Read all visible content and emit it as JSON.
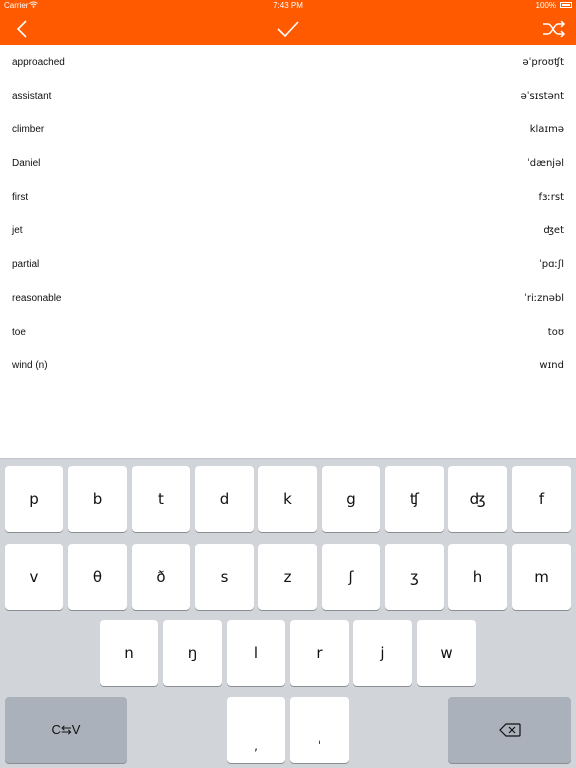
{
  "status_bar": {
    "carrier": "Carrier",
    "time": "7:43 PM",
    "battery": "100%"
  },
  "nav": {
    "accent_color": "#ff5a00",
    "back_icon": "chevron-left-icon",
    "confirm_icon": "checkmark-icon",
    "shuffle_icon": "shuffle-icon"
  },
  "words": [
    {
      "word": "approached",
      "ipa": "əˈproʊʧt"
    },
    {
      "word": "assistant",
      "ipa": "əˈsɪstənt"
    },
    {
      "word": "climber",
      "ipa": "klaɪmə"
    },
    {
      "word": "Daniel",
      "ipa": "ˈdænjəl"
    },
    {
      "word": "first",
      "ipa": "fɜːrst"
    },
    {
      "word": "jet",
      "ipa": "ʤet"
    },
    {
      "word": "partial",
      "ipa": "ˈpɑːʃl"
    },
    {
      "word": "reasonable",
      "ipa": "ˈriːznəbl"
    },
    {
      "word": "toe",
      "ipa": "toʊ"
    },
    {
      "word": "wind (n)",
      "ipa": "wɪnd"
    }
  ],
  "keyboard": {
    "row1": [
      "p",
      "b",
      "t",
      "d",
      "k",
      "g",
      "ʧ",
      "ʤ",
      "f"
    ],
    "row2": [
      "v",
      "θ",
      "ð",
      "s",
      "z",
      "ʃ",
      "ʒ",
      "h",
      "m"
    ],
    "row3": [
      "n",
      "ŋ",
      "l",
      "r",
      "j",
      "w"
    ],
    "switch_label": "C⇆V",
    "comma": ",",
    "stress": "ˈ",
    "delete_icon": "backspace-icon"
  }
}
